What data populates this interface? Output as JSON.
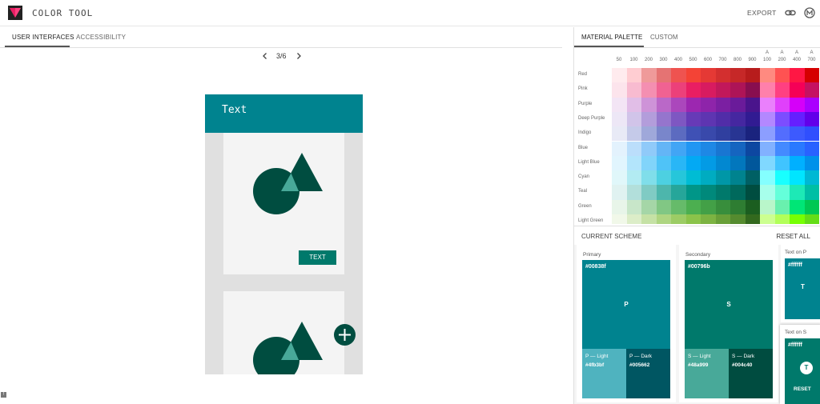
{
  "header": {
    "title": "COLOR TOOL",
    "export_label": "EXPORT",
    "link_icon": "link-icon",
    "account_icon": "material-logo-icon"
  },
  "left_tabs": [
    {
      "label": "USER INTERFACES",
      "active": true
    },
    {
      "label": "ACCESSIBILITY",
      "active": false
    }
  ],
  "pager": {
    "text": "3/6"
  },
  "preview": {
    "appbar_title": "Text",
    "button_label": "TEXT",
    "primary_color": "#00838f",
    "secondary_color": "#00796b",
    "dark_color": "#004d40",
    "light_color": "#48a999"
  },
  "right_tabs": [
    {
      "label": "MATERIAL PALETTE",
      "active": true
    },
    {
      "label": "CUSTOM",
      "active": false
    }
  ],
  "palette": {
    "columns": [
      {
        "top": "",
        "bottom": "50"
      },
      {
        "top": "",
        "bottom": "100"
      },
      {
        "top": "",
        "bottom": "200"
      },
      {
        "top": "",
        "bottom": "300"
      },
      {
        "top": "",
        "bottom": "400"
      },
      {
        "top": "",
        "bottom": "500"
      },
      {
        "top": "",
        "bottom": "600"
      },
      {
        "top": "",
        "bottom": "700"
      },
      {
        "top": "",
        "bottom": "800"
      },
      {
        "top": "",
        "bottom": "900"
      },
      {
        "top": "A",
        "bottom": "100"
      },
      {
        "top": "A",
        "bottom": "200"
      },
      {
        "top": "A",
        "bottom": "400"
      },
      {
        "top": "A",
        "bottom": "700"
      }
    ],
    "rows": [
      {
        "name": "Red",
        "colors": [
          "#ffebee",
          "#ffcdd2",
          "#ef9a9a",
          "#e57373",
          "#ef5350",
          "#f44336",
          "#e53935",
          "#d32f2f",
          "#c62828",
          "#b71c1c",
          "#ff8a80",
          "#ff5252",
          "#ff1744",
          "#d50000"
        ]
      },
      {
        "name": "Pink",
        "colors": [
          "#fce4ec",
          "#f8bbd0",
          "#f48fb1",
          "#f06292",
          "#ec407a",
          "#e91e63",
          "#d81b60",
          "#c2185b",
          "#ad1457",
          "#880e4f",
          "#ff80ab",
          "#ff4081",
          "#f50057",
          "#c51162"
        ]
      },
      {
        "name": "Purple",
        "colors": [
          "#f3e5f5",
          "#e1bee7",
          "#ce93d8",
          "#ba68c8",
          "#ab47bc",
          "#9c27b0",
          "#8e24aa",
          "#7b1fa2",
          "#6a1b9a",
          "#4a148c",
          "#ea80fc",
          "#e040fb",
          "#d500f9",
          "#aa00ff"
        ]
      },
      {
        "name": "Deep Purple",
        "colors": [
          "#ede7f6",
          "#d1c4e9",
          "#b39ddb",
          "#9575cd",
          "#7e57c2",
          "#673ab7",
          "#5e35b1",
          "#512da8",
          "#4527a0",
          "#311b92",
          "#b388ff",
          "#7c4dff",
          "#651fff",
          "#6200ea"
        ]
      },
      {
        "name": "Indigo",
        "colors": [
          "#e8eaf6",
          "#c5cae9",
          "#9fa8da",
          "#7986cb",
          "#5c6bc0",
          "#3f51b5",
          "#3949ab",
          "#303f9f",
          "#283593",
          "#1a237e",
          "#8c9eff",
          "#536dfe",
          "#3d5afe",
          "#304ffe"
        ]
      },
      {
        "name": "Blue",
        "colors": [
          "#e3f2fd",
          "#bbdefb",
          "#90caf9",
          "#64b5f6",
          "#42a5f5",
          "#2196f3",
          "#1e88e5",
          "#1976d2",
          "#1565c0",
          "#0d47a1",
          "#82b1ff",
          "#448aff",
          "#2979ff",
          "#2962ff"
        ]
      },
      {
        "name": "Light Blue",
        "colors": [
          "#e1f5fe",
          "#b3e5fc",
          "#81d4fa",
          "#4fc3f7",
          "#29b6f6",
          "#03a9f4",
          "#039be5",
          "#0288d1",
          "#0277bd",
          "#01579b",
          "#80d8ff",
          "#40c4ff",
          "#00b0ff",
          "#0091ea"
        ]
      },
      {
        "name": "Cyan",
        "colors": [
          "#e0f7fa",
          "#b2ebf2",
          "#80deea",
          "#4dd0e1",
          "#26c6da",
          "#00bcd4",
          "#00acc1",
          "#0097a7",
          "#00838f",
          "#006064",
          "#84ffff",
          "#18ffff",
          "#00e5ff",
          "#00b8d4"
        ]
      },
      {
        "name": "Teal",
        "colors": [
          "#e0f2f1",
          "#b2dfdb",
          "#80cbc4",
          "#4db6ac",
          "#26a69a",
          "#009688",
          "#00897b",
          "#00796b",
          "#00695c",
          "#004d40",
          "#a7ffeb",
          "#64ffda",
          "#1de9b6",
          "#00bfa5"
        ]
      },
      {
        "name": "Green",
        "colors": [
          "#e8f5e9",
          "#c8e6c9",
          "#a5d6a7",
          "#81c784",
          "#66bb6a",
          "#4caf50",
          "#43a047",
          "#388e3c",
          "#2e7d32",
          "#1b5e20",
          "#b9f6ca",
          "#69f0ae",
          "#00e676",
          "#00c853"
        ]
      },
      {
        "name": "Light Green",
        "colors": [
          "#f1f8e9",
          "#dcedc8",
          "#c5e1a5",
          "#aed581",
          "#9ccc65",
          "#8bc34a",
          "#7cb342",
          "#689f38",
          "#558b2f",
          "#33691e",
          "#ccff90",
          "#b2ff59",
          "#76ff03",
          "#64dd17"
        ]
      }
    ]
  },
  "scheme": {
    "title": "CURRENT SCHEME",
    "reset_all": "RESET ALL",
    "primary": {
      "label": "Primary",
      "hex": "#00838f",
      "letter": "P",
      "light_label": "P — Light",
      "light_hex": "#4fb3bf",
      "dark_label": "P — Dark",
      "dark_hex": "#005662"
    },
    "secondary": {
      "label": "Secondary",
      "hex": "#00796b",
      "letter": "S",
      "light_label": "S — Light",
      "light_hex": "#48a999",
      "dark_label": "S — Dark",
      "dark_hex": "#004c40"
    },
    "text_on_p": {
      "label": "Text on P",
      "hex": "#ffffff",
      "letter": "T"
    },
    "text_on_s": {
      "label": "Text on S",
      "hex": "#ffffff",
      "letter": "T",
      "reset": "RESET"
    }
  }
}
